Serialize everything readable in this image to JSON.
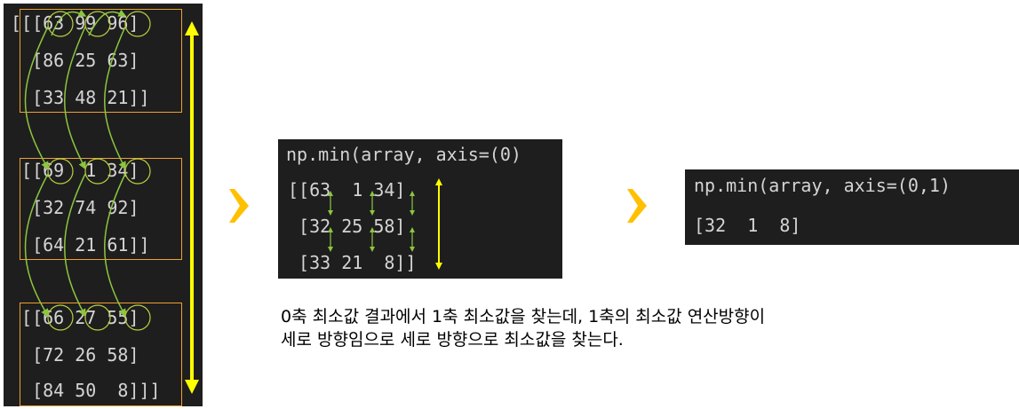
{
  "left_panel": {
    "blocks": [
      {
        "lines": [
          "[[[63 99 96]",
          "  [86 25 63]",
          "  [33 48 21]]"
        ]
      },
      {
        "lines": [
          " [[69  1 34]",
          "  [32 74 92]",
          "  [64 21 61]]"
        ]
      },
      {
        "lines": [
          " [[66 27 55]",
          "  [72 26 58]",
          "  [84 50  8]]]"
        ]
      }
    ]
  },
  "middle_panel": {
    "header": "np.min(array, axis=(0)",
    "lines": [
      "[[63  1 34]",
      " [32 25 58]",
      " [33 21  8]]"
    ]
  },
  "right_panel": {
    "header": "np.min(array, axis=(0,1)",
    "result": "[32  1  8]"
  },
  "caption": {
    "line1": "0축 최소값 결과에서 1축 최소값을 찾는데, 1축의 최소값 연산방향이",
    "line2": "세로 방향임으로 세로 방향으로 최소값을 찾는다."
  },
  "colors": {
    "panel_bg": "#1e1e1e",
    "text": "#d4d4d4",
    "box_border": "#f0a030",
    "green_arrow": "#8cc63f",
    "yellow_arrow": "#ffff00",
    "orange_chevron": "#ffc000"
  }
}
